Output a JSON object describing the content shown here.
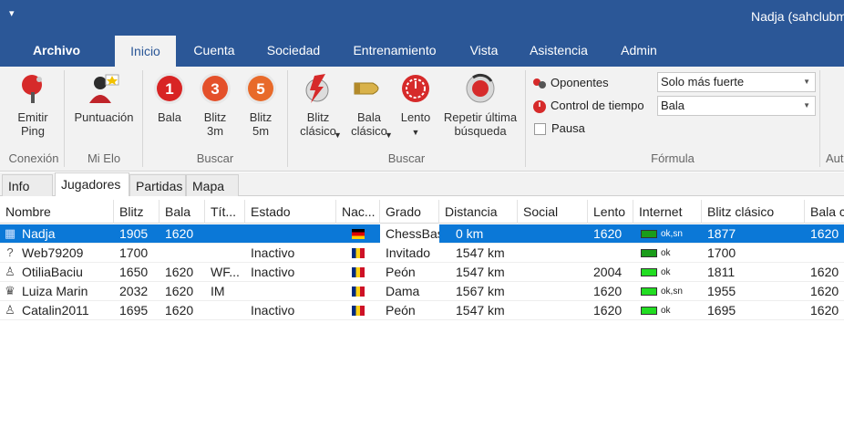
{
  "titlebar": {
    "qa_glyph": "▾",
    "user": "Nadja (sahclubm"
  },
  "ribbon_tabs": [
    "Archivo",
    "Inicio",
    "Cuenta",
    "Sociedad",
    "Entrenamiento",
    "Vista",
    "Asistencia",
    "Admin"
  ],
  "ribbon": {
    "emitir_ping": "Emitir\nPing",
    "puntuacion": "Puntuación",
    "bala": "Bala",
    "blitz3": "Blitz\n3m",
    "blitz5": "Blitz\n5m",
    "blitz_clasico": "Blitz\nclásico",
    "bala_clasico": "Bala\nclásico",
    "lento": "Lento",
    "repetir": "Repetir última\nbúsqueda",
    "groups": {
      "conexion": "Conexión",
      "mi_elo": "Mi Elo",
      "buscar1": "Buscar",
      "buscar2": "Buscar",
      "formula": "Fórmula",
      "aut": "Aut"
    },
    "badge_1": "1",
    "badge_3": "3",
    "badge_5": "5",
    "oponentes_label": "Oponentes",
    "oponentes_value": "Solo más fuerte",
    "control_label": "Control de tiempo",
    "control_value": "Bala",
    "pausa_label": "Pausa"
  },
  "subtabs": [
    "Info",
    "Jugadores",
    "Partidas",
    "Mapa"
  ],
  "columns": [
    "Nombre",
    "Blitz",
    "Bala",
    "Tít...",
    "Estado",
    "Nac...",
    "Grado",
    "Distancia",
    "Social",
    "Lento",
    "Internet",
    "Blitz clásico",
    "Bala c"
  ],
  "rows": [
    {
      "icon": "▦",
      "nombre": "Nadja",
      "blitz": "1905",
      "bala": "1620",
      "titulo": "",
      "estado": "",
      "flag": "de",
      "grado": "ChessBase",
      "distancia": "0 km",
      "social": "",
      "lento": "1620",
      "internet": "ok,sn",
      "net_color": "#1a9c1a",
      "blitz_clasico": "1877",
      "bala_clasico": "1620"
    },
    {
      "icon": "?",
      "nombre": "Web79209",
      "blitz": "1700",
      "bala": "",
      "titulo": "",
      "estado": "Inactivo",
      "flag": "ro",
      "grado": "Invitado",
      "distancia": "1547 km",
      "social": "",
      "lento": "",
      "internet": "ok",
      "net_color": "#1a9c1a",
      "blitz_clasico": "1700",
      "bala_clasico": ""
    },
    {
      "icon": "♙",
      "nombre": "OtiliaBaciu",
      "blitz": "1650",
      "bala": "1620",
      "titulo": "WF...",
      "estado": "Inactivo",
      "flag": "ro",
      "grado": "Peón",
      "distancia": "1547 km",
      "social": "",
      "lento": "2004",
      "internet": "ok",
      "net_color": "#22dd22",
      "blitz_clasico": "1811",
      "bala_clasico": "1620"
    },
    {
      "icon": "♛",
      "nombre": "Luiza Marin",
      "blitz": "2032",
      "bala": "1620",
      "titulo": "IM",
      "estado": "",
      "flag": "ro",
      "grado": "Dama",
      "distancia": "1567 km",
      "social": "",
      "lento": "1620",
      "internet": "ok,sn",
      "net_color": "#22dd22",
      "blitz_clasico": "1955",
      "bala_clasico": "1620"
    },
    {
      "icon": "♙",
      "nombre": "Catalin2011",
      "blitz": "1695",
      "bala": "1620",
      "titulo": "",
      "estado": "Inactivo",
      "flag": "ro",
      "grado": "Peón",
      "distancia": "1547 km",
      "social": "",
      "lento": "1620",
      "internet": "ok",
      "net_color": "#22dd22",
      "blitz_clasico": "1695",
      "bala_clasico": "1620"
    }
  ]
}
